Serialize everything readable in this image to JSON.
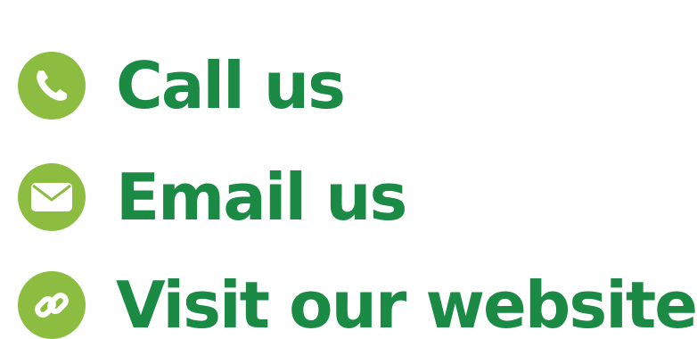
{
  "colors": {
    "icon_background": "#8cbd40",
    "text": "#1a8a44",
    "icon_glyph": "#ffffff"
  },
  "contacts": [
    {
      "icon": "phone-icon",
      "label": "Call us"
    },
    {
      "icon": "envelope-icon",
      "label": "Email us"
    },
    {
      "icon": "link-icon",
      "label": "Visit our website"
    }
  ]
}
